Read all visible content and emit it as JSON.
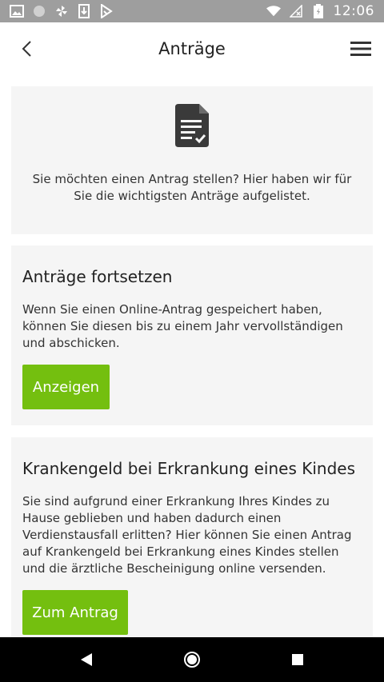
{
  "status_bar": {
    "time": "12:06",
    "icons": [
      "gallery-icon",
      "circle-icon",
      "fan-icon",
      "sim-download-icon",
      "play-store-icon",
      "wifi-icon",
      "no-signal-icon",
      "battery-icon"
    ]
  },
  "header": {
    "title": "Anträge",
    "back_icon": "chevron-left-icon",
    "menu_icon": "hamburger-menu-icon"
  },
  "intro": {
    "icon": "document-check-icon",
    "text": "Sie möchten einen Antrag stellen? Hier haben wir für Sie die wichtigsten Anträge aufgelistet."
  },
  "cards": [
    {
      "title": "Anträge fortsetzen",
      "body": "Wenn Sie einen Online-Antrag gespeichert haben, können Sie diesen bis zu einem Jahr vervollständigen und abschicken.",
      "button_label": "Anzeigen"
    },
    {
      "title": "Krankengeld bei Erkrankung eines Kindes",
      "body": "Sie sind aufgrund einer Erkrankung Ihres Kindes zu Hause geblieben und haben dadurch einen Verdienstausfall erlitten? Hier können Sie einen Antrag auf Krankengeld bei Erkrankung eines Kindes stellen und die ärztliche Bescheinigung online versenden.",
      "button_label": "Zum Antrag"
    }
  ],
  "colors": {
    "accent_green": "#74bf0f",
    "card_background": "#f5f5f5",
    "status_bar": "#9e9e9e",
    "nav_bar": "#000000"
  },
  "nav_bar": {
    "icons": [
      "nav-back-icon",
      "nav-home-icon",
      "nav-recents-icon"
    ]
  }
}
